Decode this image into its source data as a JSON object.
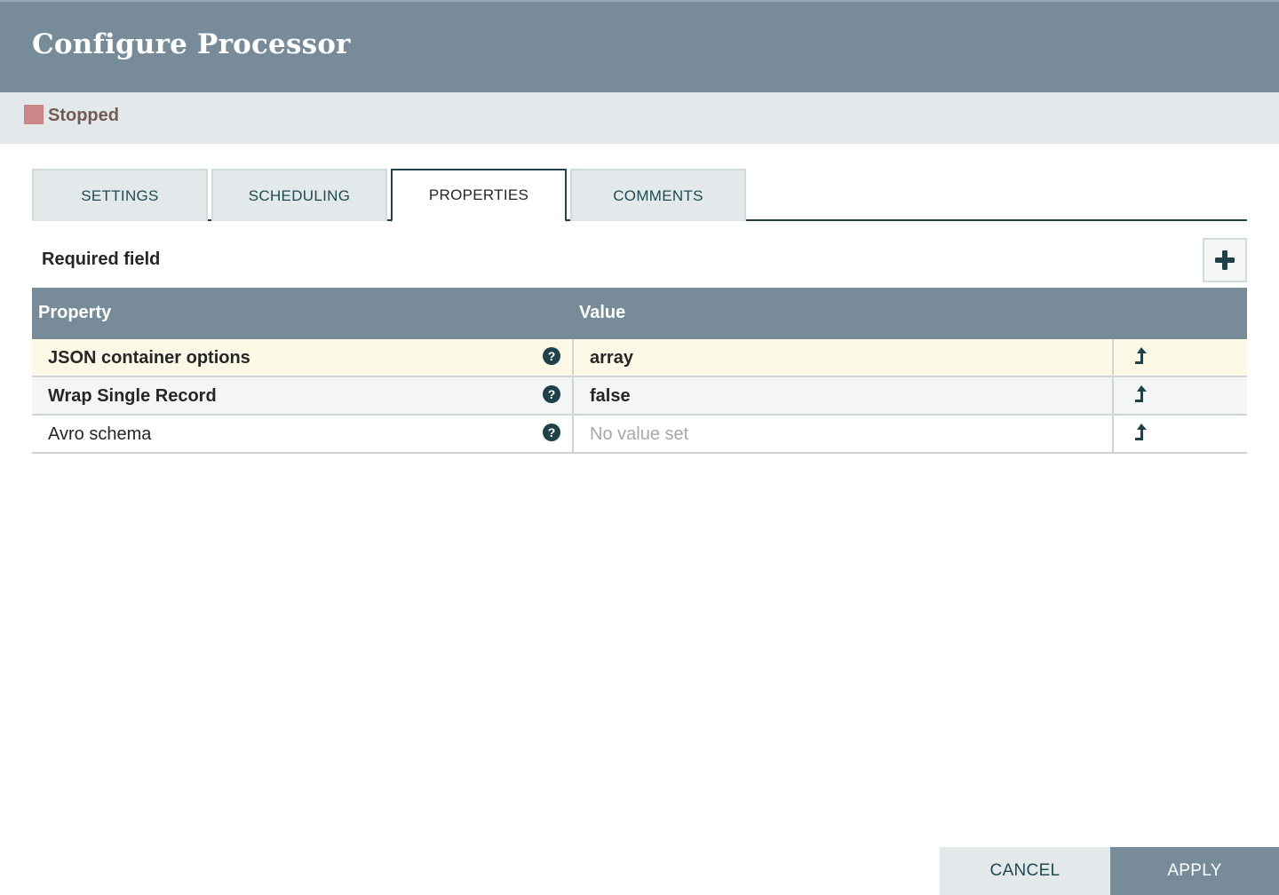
{
  "dialog": {
    "title": "Configure Processor"
  },
  "status": {
    "label": "Stopped",
    "color": "#cc8888"
  },
  "tabs": [
    {
      "label": "SETTINGS",
      "active": false
    },
    {
      "label": "SCHEDULING",
      "active": false
    },
    {
      "label": "PROPERTIES",
      "active": true
    },
    {
      "label": "COMMENTS",
      "active": false
    }
  ],
  "properties": {
    "required_label": "Required field",
    "add_button_icon": "plus-icon",
    "columns": {
      "property": "Property",
      "value": "Value"
    },
    "rows": [
      {
        "name": "JSON container options",
        "required": true,
        "value": "array",
        "value_set": true,
        "help_icon": "question-circle-icon",
        "action_icon": "convert-to-parameter-icon"
      },
      {
        "name": "Wrap Single Record",
        "required": true,
        "value": "false",
        "value_set": true,
        "help_icon": "question-circle-icon",
        "action_icon": "convert-to-parameter-icon"
      },
      {
        "name": "Avro schema",
        "required": false,
        "value": "No value set",
        "value_set": false,
        "help_icon": "question-circle-icon",
        "action_icon": "convert-to-parameter-icon"
      }
    ]
  },
  "footer": {
    "cancel_label": "CANCEL",
    "apply_label": "APPLY"
  },
  "colors": {
    "header_bg": "#778b98",
    "accent_dark": "#1f4147",
    "status_bar_bg": "#e3e8eb",
    "highlight_row": "#fdf9e7"
  }
}
